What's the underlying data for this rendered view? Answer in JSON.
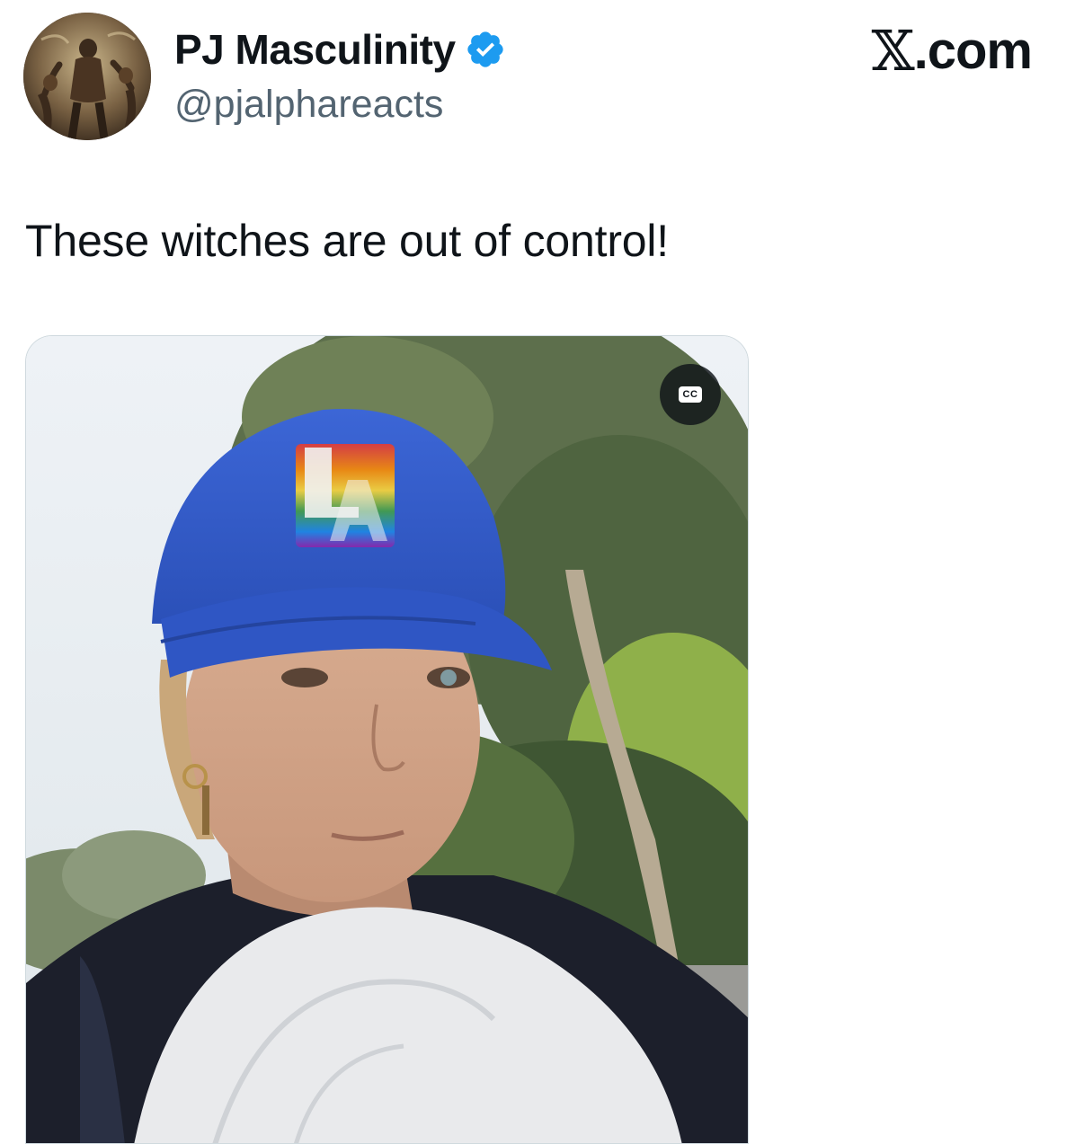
{
  "post": {
    "author": {
      "display_name": "PJ Masculinity",
      "handle": "@pjalphareacts",
      "verified_icon": "verified-badge-icon",
      "avatar_icon": "avatar-image"
    },
    "brand": {
      "symbol": "𝕏",
      "domain": ".com"
    },
    "text": "These witches are out of control!",
    "media": {
      "type": "video-thumbnail",
      "captions_button_label": "CC"
    }
  },
  "colors": {
    "text_primary": "#0f1419",
    "text_secondary": "#536471",
    "verified_blue": "#1d9bf0",
    "media_border": "#cfd9de"
  }
}
